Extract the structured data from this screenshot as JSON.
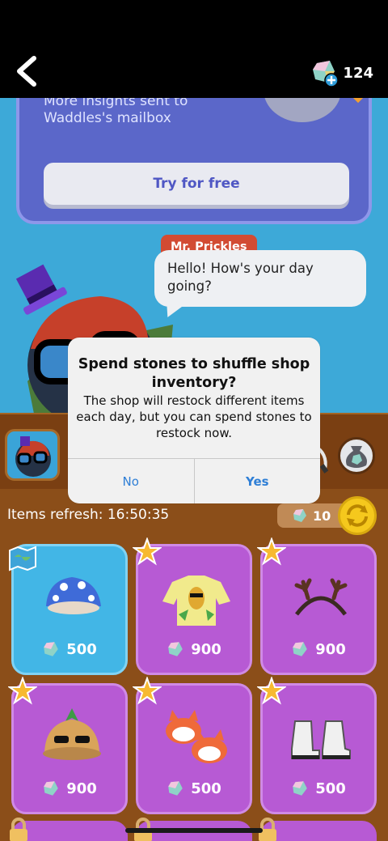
{
  "header": {
    "back_icon": "chevron-left-icon",
    "stones_count": "124"
  },
  "promo": {
    "line1": "More insights sent to",
    "line2": "Waddles's mailbox",
    "try_button": "Try for free"
  },
  "chat": {
    "speaker": "Mr. Prickles",
    "message": "Hello! How's your day going?"
  },
  "shop": {
    "refresh_label": "Items refresh: 16:50:35",
    "shuffle_cost": "10",
    "items": [
      {
        "name": "blue-mushroom-hat",
        "price": "500"
      },
      {
        "name": "fruit-sweater",
        "price": "900"
      },
      {
        "name": "antlers-headband",
        "price": "900"
      },
      {
        "name": "pineapple-hat",
        "price": "900"
      },
      {
        "name": "fox-slippers",
        "price": "500"
      },
      {
        "name": "white-boots",
        "price": "500"
      }
    ]
  },
  "dialog": {
    "title": "Spend stones to shuffle shop inventory?",
    "message": "The shop will restock different items each day, but you can spend stones to restock now.",
    "no_label": "No",
    "yes_label": "Yes"
  },
  "colors": {
    "sky": "#3da9d8",
    "tile_purple": "#b75ad4",
    "tile_blue": "#42b6e6",
    "shelf": "#8b4e19",
    "dialog_button": "#2f7fd6"
  }
}
